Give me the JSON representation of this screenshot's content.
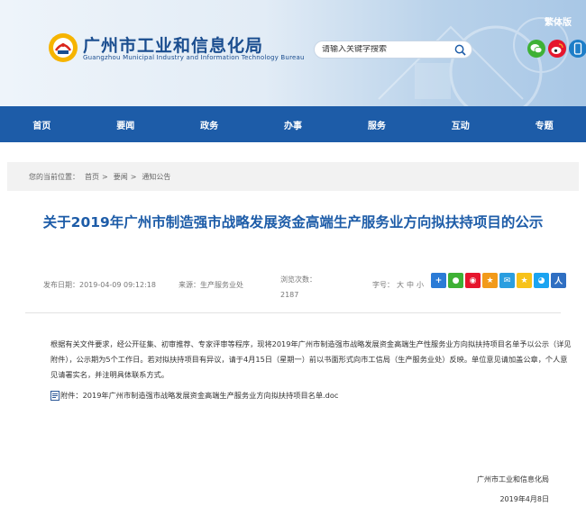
{
  "header": {
    "site_title": "广州市工业和信息化局",
    "site_subtitle": "Guangzhou Municipal Industry and Information Technology Bureau",
    "traditional_link": "繁体版",
    "search_placeholder": "请输入关键字搜索"
  },
  "nav": [
    "首页",
    "要闻",
    "政务",
    "办事",
    "服务",
    "互动",
    "专题"
  ],
  "breadcrumb": {
    "prefix": "您的当前位置：",
    "items": [
      "首页",
      "要闻",
      "通知公告"
    ],
    "separator": ">"
  },
  "article": {
    "title": "关于2019年广州市制造强市战略发展资金高端生产服务业方向拟扶持项目的公示",
    "date": "发布日期：2019-04-09 09:12:18",
    "source": "来源：生产服务业处",
    "views_label": "浏览次数：",
    "views": "2187",
    "font_size_label": "字号：",
    "font_sizes": [
      "大",
      "中",
      "小"
    ],
    "body": "根据有关文件要求，经公开征集、初审推荐、专家评审等程序，现将2019年广州市制造强市战略发展资金高端生产性服务业方向拟扶持项目名单予以公示（详见附件），公示期为5个工作日。若对拟扶持项目有异议，请于4月15日（星期一）前以书面形式向市工信局（生产服务业处）反映。单位意见请加盖公章，个人意见请署实名，并注明具体联系方式。",
    "attachment": "附件：2019年广州市制造强市战略发展资金高端生产服务业方向拟扶持项目名单.doc",
    "signature": "广州市工业和信息化局",
    "sign_date": "2019年4月8日"
  },
  "colors": {
    "nav_bg": "#1d5ca8",
    "title_blue": "#1d5ca8",
    "breadcrumb_bg": "#f2f2f2"
  }
}
